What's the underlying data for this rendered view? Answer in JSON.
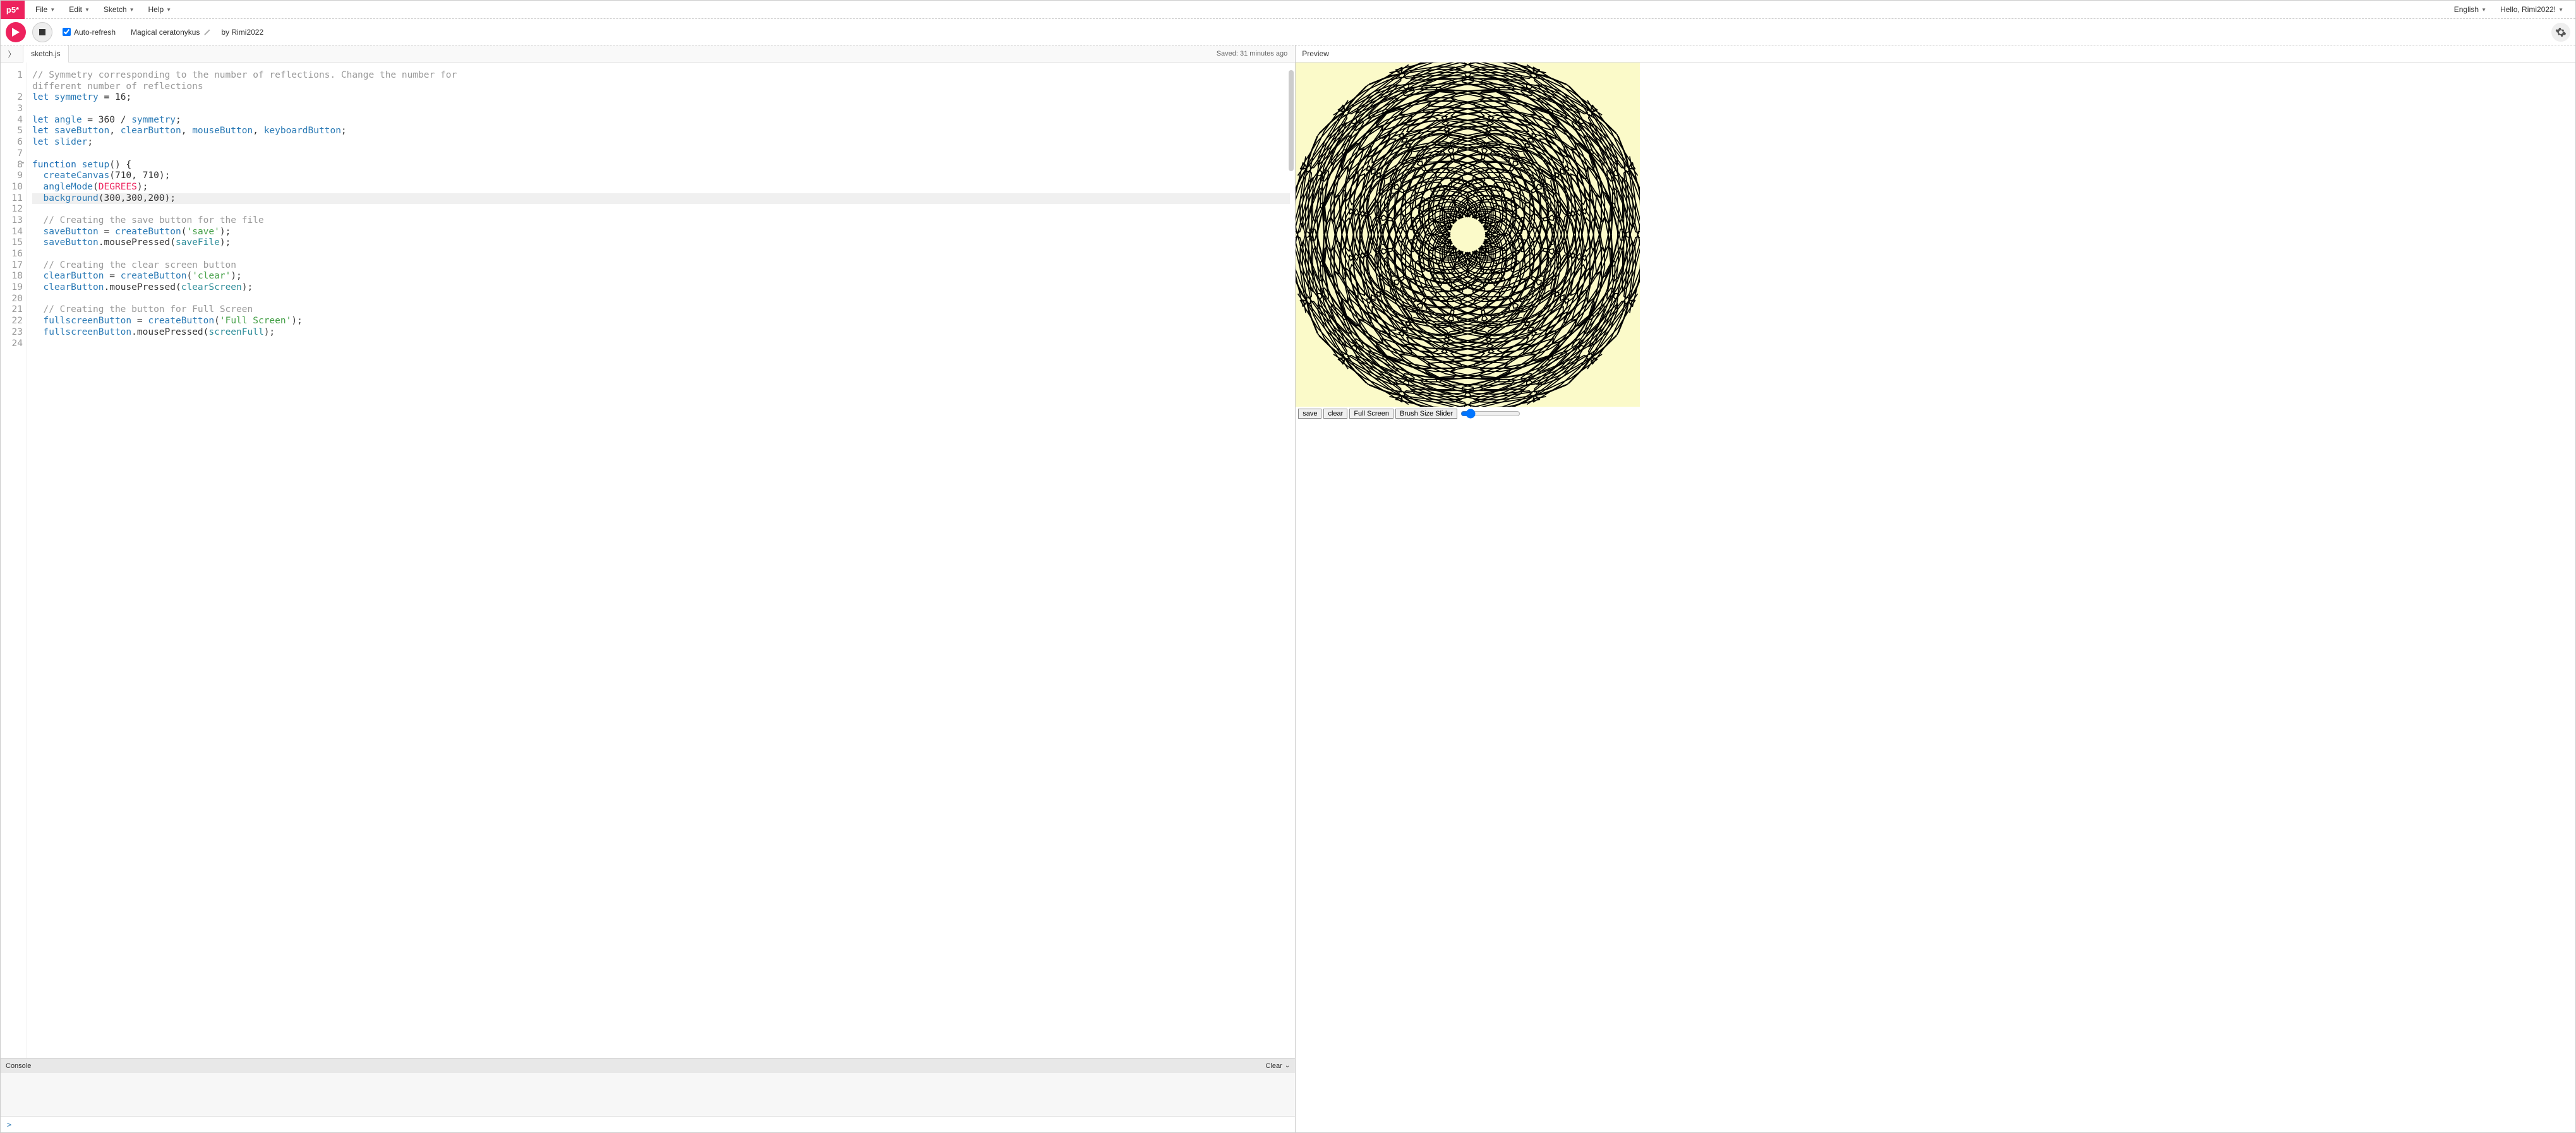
{
  "logo": "p5*",
  "menu": {
    "file": "File",
    "edit": "Edit",
    "sketch": "Sketch",
    "help": "Help",
    "language": "English",
    "greeting": "Hello, Rimi2022!"
  },
  "toolbar": {
    "autorefresh_label": "Auto-refresh",
    "autorefresh_checked": true,
    "sketch_name": "Magical ceratonykus",
    "by": "by",
    "author": "Rimi2022"
  },
  "editor": {
    "filename": "sketch.js",
    "saved_label": "Saved: 31 minutes ago",
    "active_line": 11,
    "lines": [
      {
        "n": 1,
        "tokens": [
          {
            "t": "// Symmetry corresponding to the number of reflections. Change the number for",
            "c": "c-comment"
          }
        ]
      },
      {
        "n": null,
        "tokens": [
          {
            "t": "different number of reflections",
            "c": "c-comment"
          }
        ]
      },
      {
        "n": 2,
        "tokens": [
          {
            "t": "let ",
            "c": "c-kw"
          },
          {
            "t": "symmetry",
            "c": "c-var"
          },
          {
            "t": " = ",
            "c": ""
          },
          {
            "t": "16",
            "c": "c-num"
          },
          {
            "t": ";",
            "c": ""
          }
        ]
      },
      {
        "n": 3,
        "tokens": []
      },
      {
        "n": 4,
        "tokens": [
          {
            "t": "let ",
            "c": "c-kw"
          },
          {
            "t": "angle",
            "c": "c-var"
          },
          {
            "t": " = ",
            "c": ""
          },
          {
            "t": "360",
            "c": "c-num"
          },
          {
            "t": " / ",
            "c": ""
          },
          {
            "t": "symmetry",
            "c": "c-var"
          },
          {
            "t": ";",
            "c": ""
          }
        ]
      },
      {
        "n": 5,
        "tokens": [
          {
            "t": "let ",
            "c": "c-kw"
          },
          {
            "t": "saveButton",
            "c": "c-var"
          },
          {
            "t": ", ",
            "c": ""
          },
          {
            "t": "clearButton",
            "c": "c-var"
          },
          {
            "t": ", ",
            "c": ""
          },
          {
            "t": "mouseButton",
            "c": "c-var"
          },
          {
            "t": ", ",
            "c": ""
          },
          {
            "t": "keyboardButton",
            "c": "c-var"
          },
          {
            "t": ";",
            "c": ""
          }
        ]
      },
      {
        "n": 6,
        "tokens": [
          {
            "t": "let ",
            "c": "c-kw"
          },
          {
            "t": "slider",
            "c": "c-var"
          },
          {
            "t": ";",
            "c": ""
          }
        ]
      },
      {
        "n": 7,
        "tokens": []
      },
      {
        "n": 8,
        "fold": true,
        "tokens": [
          {
            "t": "function ",
            "c": "c-kw"
          },
          {
            "t": "setup",
            "c": "c-fn"
          },
          {
            "t": "() {",
            "c": ""
          }
        ]
      },
      {
        "n": 9,
        "tokens": [
          {
            "t": "  ",
            "c": ""
          },
          {
            "t": "createCanvas",
            "c": "c-fn"
          },
          {
            "t": "(",
            "c": ""
          },
          {
            "t": "710",
            "c": "c-num"
          },
          {
            "t": ", ",
            "c": ""
          },
          {
            "t": "710",
            "c": "c-num"
          },
          {
            "t": ");",
            "c": ""
          }
        ]
      },
      {
        "n": 10,
        "tokens": [
          {
            "t": "  ",
            "c": ""
          },
          {
            "t": "angleMode",
            "c": "c-fn"
          },
          {
            "t": "(",
            "c": ""
          },
          {
            "t": "DEGREES",
            "c": "c-const"
          },
          {
            "t": ");",
            "c": ""
          }
        ]
      },
      {
        "n": 11,
        "hl": true,
        "tokens": [
          {
            "t": "  ",
            "c": ""
          },
          {
            "t": "background",
            "c": "c-fn"
          },
          {
            "t": "(",
            "c": ""
          },
          {
            "t": "300",
            "c": "c-num"
          },
          {
            "t": ",",
            "c": ""
          },
          {
            "t": "300",
            "c": "c-num"
          },
          {
            "t": ",",
            "c": ""
          },
          {
            "t": "200",
            "c": "c-num"
          },
          {
            "t": ");",
            "c": ""
          }
        ]
      },
      {
        "n": 12,
        "tokens": []
      },
      {
        "n": 13,
        "tokens": [
          {
            "t": "  ",
            "c": ""
          },
          {
            "t": "// Creating the save button for the file",
            "c": "c-comment"
          }
        ]
      },
      {
        "n": 14,
        "tokens": [
          {
            "t": "  ",
            "c": ""
          },
          {
            "t": "saveButton",
            "c": "c-var"
          },
          {
            "t": " = ",
            "c": ""
          },
          {
            "t": "createButton",
            "c": "c-fn"
          },
          {
            "t": "(",
            "c": ""
          },
          {
            "t": "'save'",
            "c": "c-str"
          },
          {
            "t": ");",
            "c": ""
          }
        ]
      },
      {
        "n": 15,
        "tokens": [
          {
            "t": "  ",
            "c": ""
          },
          {
            "t": "saveButton",
            "c": "c-var"
          },
          {
            "t": ".",
            "c": ""
          },
          {
            "t": "mousePressed",
            "c": ""
          },
          {
            "t": "(",
            "c": ""
          },
          {
            "t": "saveFile",
            "c": "c-teal"
          },
          {
            "t": ");",
            "c": ""
          }
        ]
      },
      {
        "n": 16,
        "tokens": []
      },
      {
        "n": 17,
        "tokens": [
          {
            "t": "  ",
            "c": ""
          },
          {
            "t": "// Creating the clear screen button",
            "c": "c-comment"
          }
        ]
      },
      {
        "n": 18,
        "tokens": [
          {
            "t": "  ",
            "c": ""
          },
          {
            "t": "clearButton",
            "c": "c-var"
          },
          {
            "t": " = ",
            "c": ""
          },
          {
            "t": "createButton",
            "c": "c-fn"
          },
          {
            "t": "(",
            "c": ""
          },
          {
            "t": "'clear'",
            "c": "c-str"
          },
          {
            "t": ");",
            "c": ""
          }
        ]
      },
      {
        "n": 19,
        "tokens": [
          {
            "t": "  ",
            "c": ""
          },
          {
            "t": "clearButton",
            "c": "c-var"
          },
          {
            "t": ".",
            "c": ""
          },
          {
            "t": "mousePressed",
            "c": ""
          },
          {
            "t": "(",
            "c": ""
          },
          {
            "t": "clearScreen",
            "c": "c-teal"
          },
          {
            "t": ");",
            "c": ""
          }
        ]
      },
      {
        "n": 20,
        "tokens": []
      },
      {
        "n": 21,
        "tokens": [
          {
            "t": "  ",
            "c": ""
          },
          {
            "t": "// Creating the button for Full Screen",
            "c": "c-comment"
          }
        ]
      },
      {
        "n": 22,
        "tokens": [
          {
            "t": "  ",
            "c": ""
          },
          {
            "t": "fullscreenButton",
            "c": "c-var"
          },
          {
            "t": " = ",
            "c": ""
          },
          {
            "t": "createButton",
            "c": "c-fn"
          },
          {
            "t": "(",
            "c": ""
          },
          {
            "t": "'Full Screen'",
            "c": "c-str"
          },
          {
            "t": ");",
            "c": ""
          }
        ]
      },
      {
        "n": 23,
        "tokens": [
          {
            "t": "  ",
            "c": ""
          },
          {
            "t": "fullscreenButton",
            "c": "c-var"
          },
          {
            "t": ".",
            "c": ""
          },
          {
            "t": "mousePressed",
            "c": ""
          },
          {
            "t": "(",
            "c": ""
          },
          {
            "t": "screenFull",
            "c": "c-teal"
          },
          {
            "t": ");",
            "c": ""
          }
        ]
      },
      {
        "n": 24,
        "tokens": []
      }
    ]
  },
  "console": {
    "label": "Console",
    "clear_label": "Clear",
    "prompt": ">"
  },
  "preview": {
    "label": "Preview",
    "buttons": {
      "save": "save",
      "clear": "clear",
      "fullscreen": "Full Screen",
      "brush_slider": "Brush Size Slider"
    },
    "canvas": {
      "bg": "#fbfac9",
      "symmetry": 16,
      "stroke": "#000"
    }
  }
}
